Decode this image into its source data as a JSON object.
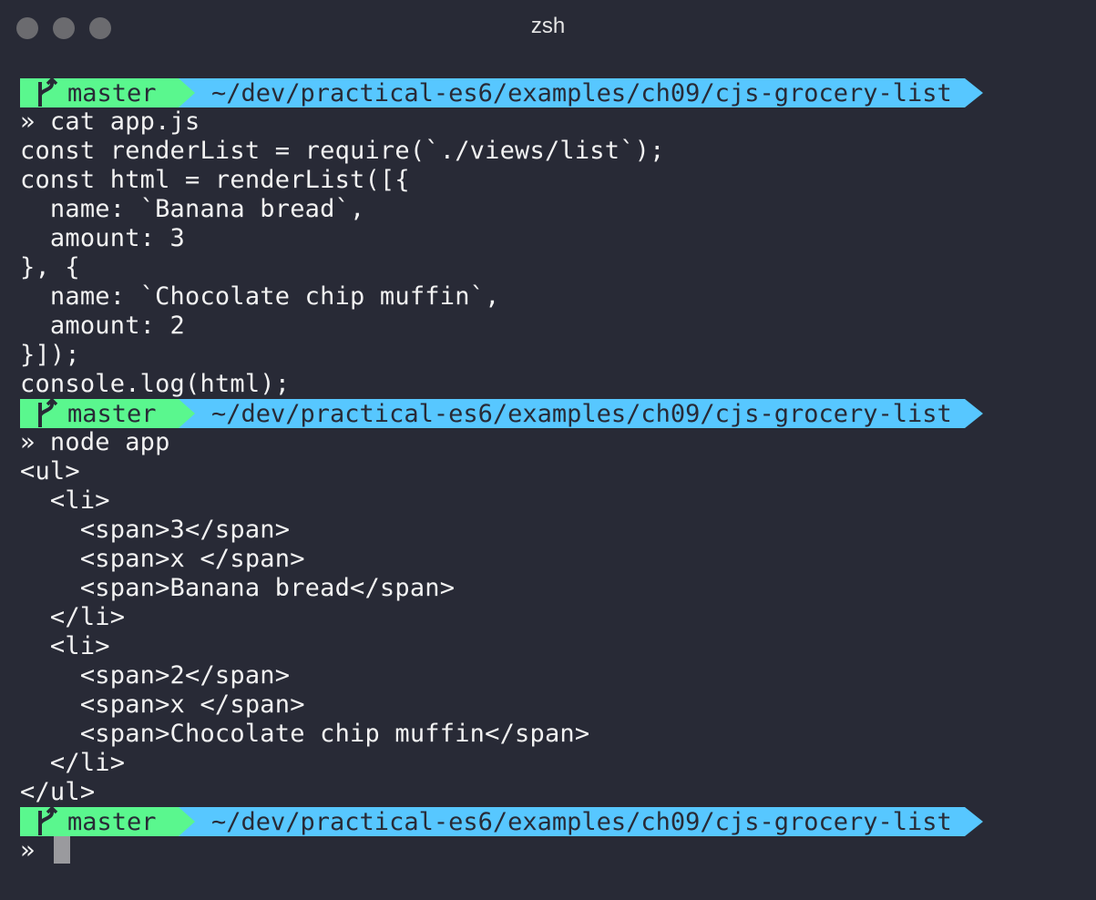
{
  "window": {
    "title": "zsh"
  },
  "prompt": {
    "branch": "master",
    "path": "~/dev/practical-es6/examples/ch09/cjs-grocery-list",
    "symbol": "»",
    "branch_color": "#5af78e",
    "path_color": "#57c7ff"
  },
  "blocks": [
    {
      "command": "» cat app.js",
      "output": [
        "const renderList = require(`./views/list`);",
        "const html = renderList([{",
        "  name: `Banana bread`,",
        "  amount: 3",
        "}, {",
        "  name: `Chocolate chip muffin`,",
        "  amount: 2",
        "}]);",
        "console.log(html);"
      ]
    },
    {
      "command": "» node app",
      "output": [
        "<ul>",
        "  <li>",
        "    <span>3</span>",
        "    <span>x </span>",
        "    <span>Banana bread</span>",
        "  </li>",
        "  <li>",
        "    <span>2</span>",
        "    <span>x </span>",
        "    <span>Chocolate chip muffin</span>",
        "  </li>",
        "</ul>"
      ]
    }
  ],
  "final_prompt_symbol": "» "
}
